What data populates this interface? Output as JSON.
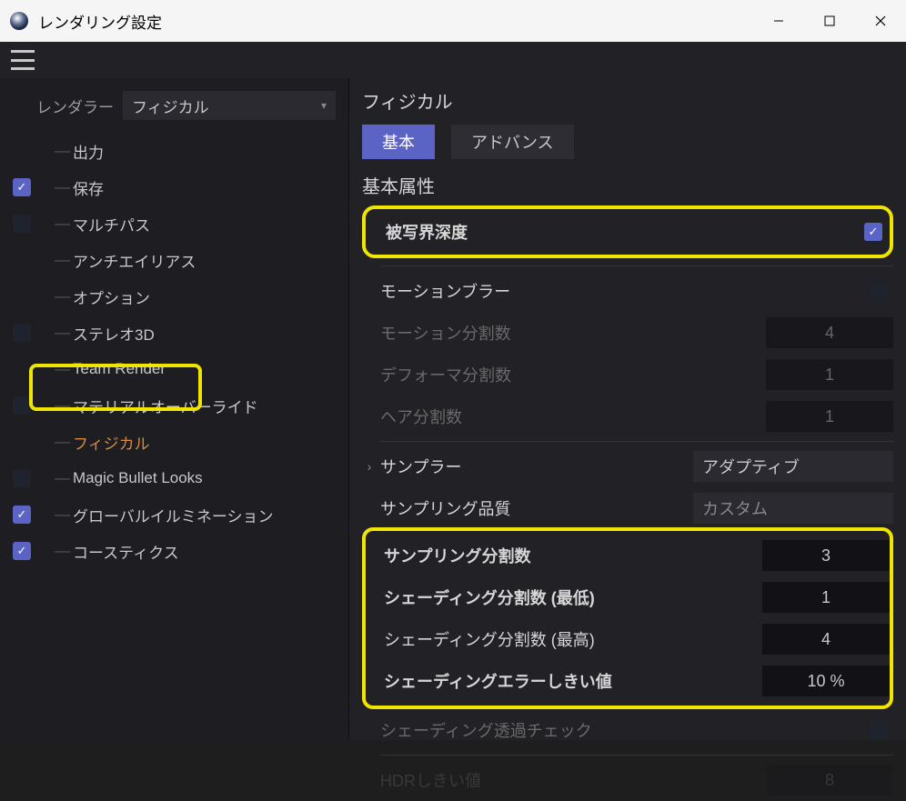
{
  "window": {
    "title": "レンダリング設定"
  },
  "renderer": {
    "label": "レンダラー",
    "selected": "フィジカル"
  },
  "tree": {
    "items": [
      {
        "label": "出力",
        "chk": "none"
      },
      {
        "label": "保存",
        "chk": "checked"
      },
      {
        "label": "マルチパス",
        "chk": "unchecked"
      },
      {
        "label": "アンチエイリアス",
        "chk": "none"
      },
      {
        "label": "オプション",
        "chk": "none"
      },
      {
        "label": "ステレオ3D",
        "chk": "unchecked"
      },
      {
        "label": "Team Render",
        "chk": "none"
      },
      {
        "label": "マテリアルオーバーライド",
        "chk": "unchecked"
      },
      {
        "label": "フィジカル",
        "chk": "none",
        "selected": true
      },
      {
        "label": "Magic Bullet Looks",
        "chk": "unchecked"
      },
      {
        "label": "グローバルイルミネーション",
        "chk": "checked"
      },
      {
        "label": "コースティクス",
        "chk": "checked"
      }
    ]
  },
  "main": {
    "title": "フィジカル",
    "tabs": {
      "basic": "基本",
      "advance": "アドバンス"
    },
    "section_basic": "基本属性",
    "props": {
      "dof": "被写界深度",
      "motionblur": "モーションブラー",
      "motion_sub": "モーション分割数",
      "motion_sub_v": "4",
      "deformer_sub": "デフォーマ分割数",
      "deformer_sub_v": "1",
      "hair_sub": "ヘア分割数",
      "hair_sub_v": "1",
      "sampler": "サンプラー",
      "sampler_v": "アダプティブ",
      "sampling_q": "サンプリング品質",
      "sampling_q_v": "カスタム",
      "sampling_sub": "サンプリング分割数",
      "sampling_sub_v": "3",
      "shading_min": "シェーディング分割数 (最低)",
      "shading_min_v": "1",
      "shading_max": "シェーディング分割数 (最高)",
      "shading_max_v": "4",
      "shading_err": "シェーディングエラーしきい値",
      "shading_err_v": "10 %",
      "shading_trans": "シェーディング透過チェック",
      "hdr_thresh": "HDRしきい値",
      "hdr_thresh_v": "8"
    }
  }
}
